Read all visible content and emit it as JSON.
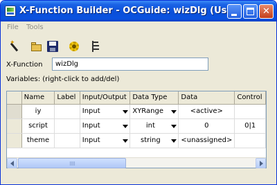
{
  "window": {
    "title": "X-Function Builder - OCGuide: wizDlg (User)",
    "accent_color": "#0a4fd8",
    "controls": {
      "minimize_icon": "minimize-icon",
      "maximize_icon": "maximize-icon",
      "close_icon": "close-icon",
      "close_glyph": "✕"
    }
  },
  "menu": {
    "file": "File",
    "tools": "Tools"
  },
  "toolbar": {
    "icons": [
      "new-wand-icon",
      "open-folder-icon",
      "save-disk-icon",
      "compile-gear-icon",
      "tree-view-icon"
    ]
  },
  "xfunction": {
    "label": "X-Function",
    "value": "wizDlg"
  },
  "variables": {
    "label": "Variables: (right-click to add/del)"
  },
  "grid": {
    "columns": [
      "Name",
      "Label",
      "Input/Output",
      "Data Type",
      "Data",
      "Control"
    ],
    "rows": [
      {
        "name": "iy",
        "label": "",
        "io": "Input",
        "type": "XYRange",
        "data": "<active>",
        "control": ""
      },
      {
        "name": "script",
        "label": "",
        "io": "Input",
        "type": "int",
        "data": "0",
        "control": "0|1"
      },
      {
        "name": "theme",
        "label": "",
        "io": "Input",
        "type": "string",
        "data": "<unassigned>",
        "control": ""
      }
    ]
  },
  "scrollbar": {
    "grip": "III"
  }
}
